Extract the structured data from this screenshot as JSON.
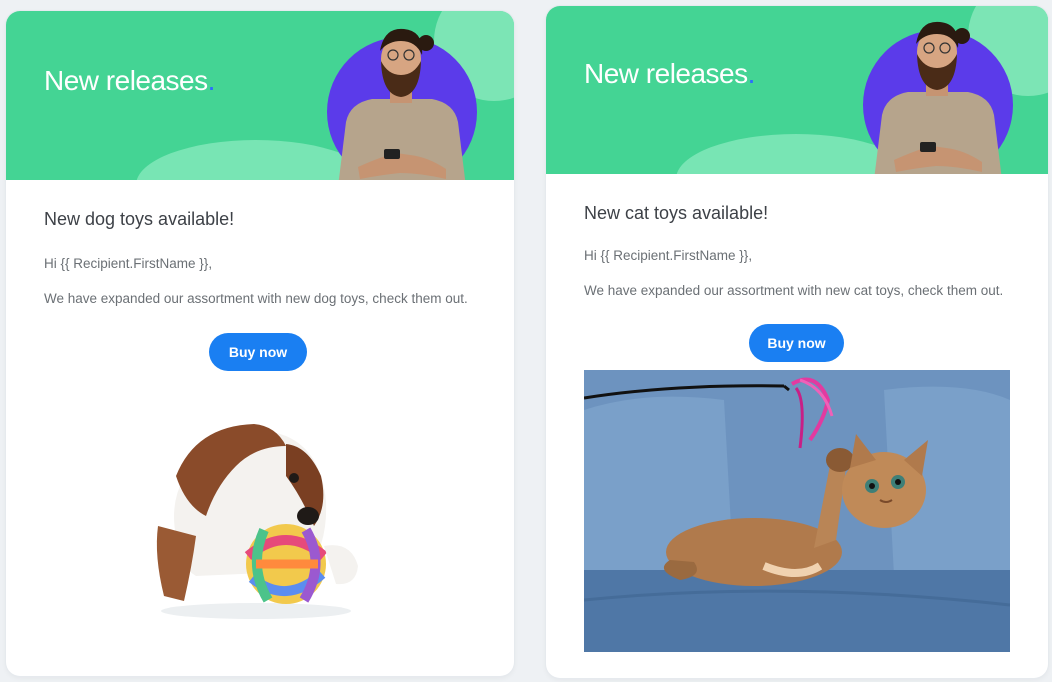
{
  "cards": [
    {
      "banner_title": "New releases",
      "banner_dot": ".",
      "headline": "New dog toys available!",
      "greeting": "Hi {{ Recipient.FirstName }},",
      "body": "We have expanded our assortment with new dog toys, check them out.",
      "button_label": "Buy now"
    },
    {
      "banner_title": "New releases",
      "banner_dot": ".",
      "headline": "New cat toys available!",
      "greeting": "Hi {{ Recipient.FirstName }},",
      "body": "We have expanded our assortment with new cat toys, check them out.",
      "button_label": "Buy now"
    }
  ],
  "colors": {
    "banner_green": "#44d494",
    "accent_purple": "#5b3bea",
    "button_blue": "#1a7ff2",
    "dot_blue": "#2b6cff"
  }
}
